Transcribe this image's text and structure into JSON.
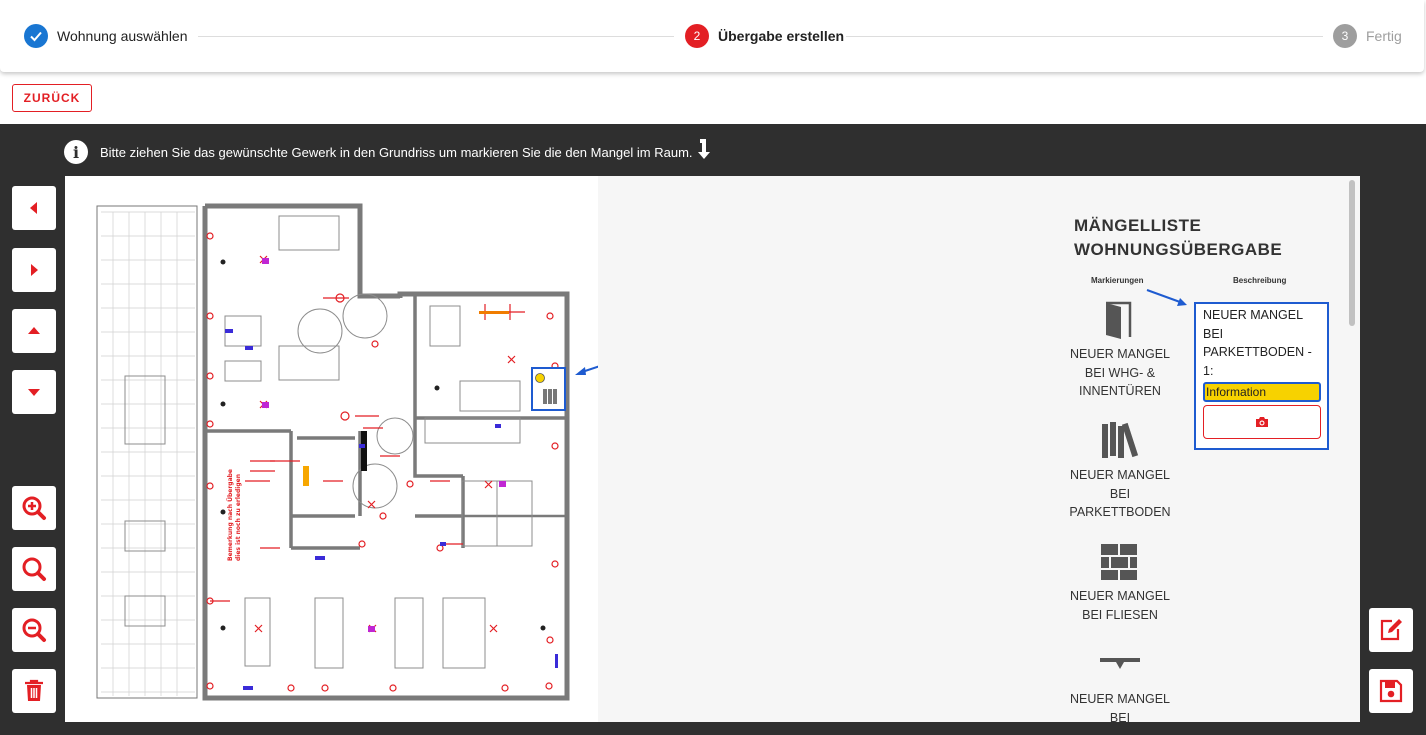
{
  "stepper": {
    "steps": [
      {
        "label": "Wohnung auswählen",
        "state": "done"
      },
      {
        "number": "2",
        "label": "Übergabe erstellen",
        "state": "active"
      },
      {
        "number": "3",
        "label": "Fertig",
        "state": "pending"
      }
    ]
  },
  "back_label": "ZURÜCK",
  "instruction": "Bitte ziehen Sie das gewünschte Gewerk in den Grundriss um markieren Sie die den Mangel im Raum.",
  "panel": {
    "title_line1": "MÄNGELLISTE",
    "title_line2": "WOHNUNGSÜBERGABE",
    "col_markings": "Markierungen",
    "col_description": "Beschreibung",
    "items": [
      {
        "line1": "NEUER MANGEL",
        "line2": "BEI WHG- &",
        "line3": "INNENTÜREN",
        "icon": "door-icon"
      },
      {
        "line1": "NEUER MANGEL",
        "line2": "BEI",
        "line3": "PARKETTBODEN",
        "icon": "parquet-icon"
      },
      {
        "line1": "NEUER MANGEL",
        "line2": "BEI FLIESEN",
        "icon": "tiles-icon"
      },
      {
        "line1": "NEUER MANGEL",
        "line2": "BEI",
        "icon": "ceiling-icon"
      }
    ],
    "description": {
      "l1": "NEUER MANGEL",
      "l2": "BEI",
      "l3": "PARKETTBODEN -",
      "l4": "1:",
      "input_value": "Information"
    }
  },
  "colors": {
    "accent": "#e31f24",
    "done": "#1976d2",
    "marker_blue": "#1e5bd0",
    "highlight": "#f7d200",
    "dark_bg": "#2f2f2f"
  }
}
